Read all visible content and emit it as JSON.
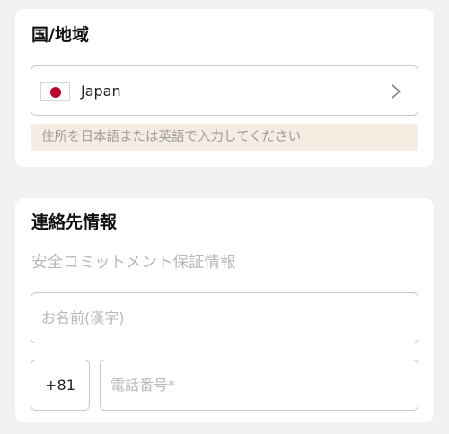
{
  "region_section": {
    "title": "国/地域",
    "country": {
      "flag": "japan-flag-icon",
      "name": "Japan"
    },
    "notice": "住所を日本語または英語で入力してください"
  },
  "contact_section": {
    "title": "連絡先情報",
    "subtitle": "安全コミットメント保証情報",
    "name_placeholder": "お名前(漢字)",
    "country_code": "+81",
    "phone_placeholder": "電話番号*"
  },
  "colors": {
    "page_background": "#f1f1f1",
    "card_background": "#ffffff",
    "notice_background": "#f7ece1",
    "placeholder_text": "#b9b9b9",
    "flag_red": "#bc002d"
  }
}
